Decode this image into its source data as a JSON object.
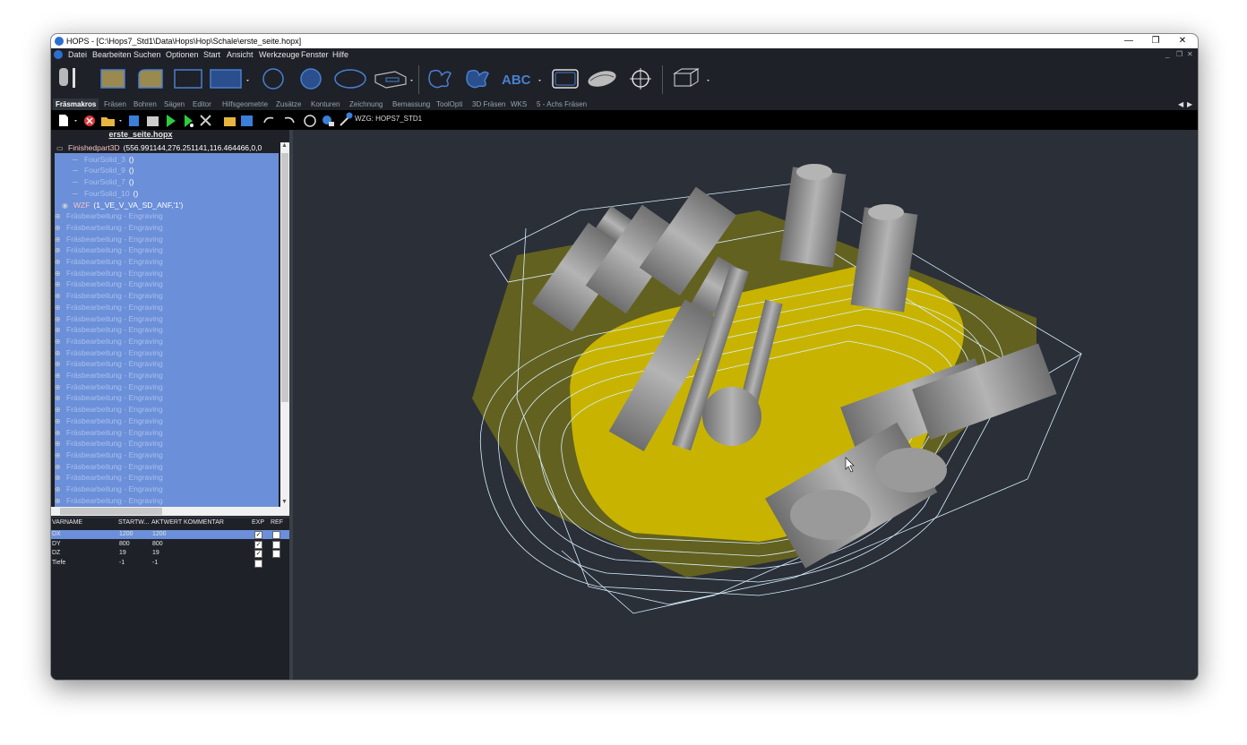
{
  "window": {
    "title": "HOPS - [C:\\Hops7_Std1\\Data\\Hops\\Hop\\Schale\\erste_seite.hopx]",
    "controls": [
      "—",
      "❐",
      "✕"
    ]
  },
  "menu": {
    "items": [
      "Datei",
      "Bearbeiten",
      "Suchen",
      "Optionen",
      "Start",
      "Ansicht",
      "Werkzeuge",
      "Fenster",
      "Hilfe"
    ],
    "mdi_controls": [
      "_",
      "❐",
      "✕"
    ]
  },
  "toolbar": {
    "abc_label": "ABC"
  },
  "tabs": [
    "Fräsmakros",
    "Fräsen",
    "Bohren",
    "Sägen",
    "Editor",
    "Hilfsgeometrie",
    "Zusätze",
    "Konturen",
    "Zeichnung",
    "Bemassung",
    "ToolOpti",
    "3D Fräsen",
    "WKS",
    "5 - Achs Fräsen"
  ],
  "toolbar2": {
    "tool_label": "WZG: HOPS7_STD1"
  },
  "tree": {
    "title": "erste_seite.hopx",
    "root": {
      "name": "Finishedpart3D",
      "params": "(556.991144,276.251141,116.464466,0,0"
    },
    "solids": [
      {
        "name": "FourSolid_3",
        "params": "()"
      },
      {
        "name": "FourSolid_9",
        "params": "()"
      },
      {
        "name": "FourSolid_7",
        "params": "()"
      },
      {
        "name": "FourSolid_10",
        "params": "()"
      }
    ],
    "wzf": {
      "name": "WZF",
      "params": "(1_VE_V_VA_SD_ANF,'1')"
    },
    "operation_label": "Fräsbearbeitung - Engraving",
    "operation_count": 26
  },
  "variables": {
    "headers": [
      "VARNAME",
      "STARTW...",
      "AKTWERT",
      "KOMMENTAR",
      "EXP",
      "REF"
    ],
    "rows": [
      {
        "name": "DX",
        "start": "1200",
        "current": "1200",
        "exp": true,
        "ref": false,
        "selected": true
      },
      {
        "name": "DY",
        "start": "800",
        "current": "800",
        "exp": true,
        "ref": false,
        "selected": false
      },
      {
        "name": "DZ",
        "start": "19",
        "current": "19",
        "exp": true,
        "ref": false,
        "selected": false
      },
      {
        "name": "Tiefe",
        "start": "-1",
        "current": "-1",
        "exp": false,
        "ref": null,
        "selected": false
      }
    ]
  },
  "colors": {
    "tree_selection": "#6b8fd8",
    "viewport_bg": "#2a2f38",
    "part": "#c8b400",
    "toolpath": "#d8f0ff",
    "tool": "#8c8c8c"
  }
}
